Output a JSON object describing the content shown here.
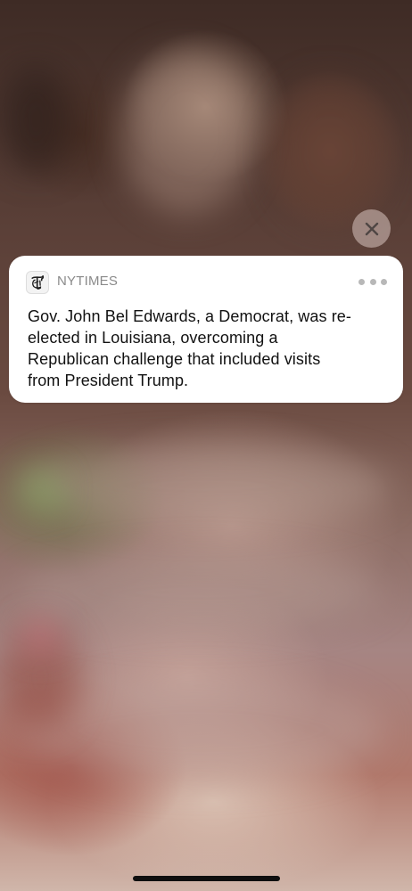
{
  "colors": {
    "card_background": "#ffffff",
    "body_text": "#111111",
    "secondary_text": "#8a8a8a",
    "close_button_background": "#d2beb9",
    "home_indicator": "#0f0f0f"
  },
  "close_button": {
    "icon": "close-icon"
  },
  "notification": {
    "app_icon": "nytimes-logo-icon",
    "app_name": "NYTIMES",
    "more_icon": "more-options-icon",
    "body_lines": [
      "Gov. John Bel Edwards, a Democrat, was re-",
      "elected in Louisiana, overcoming a",
      "Republican challenge that included visits",
      "from President Trump."
    ]
  }
}
